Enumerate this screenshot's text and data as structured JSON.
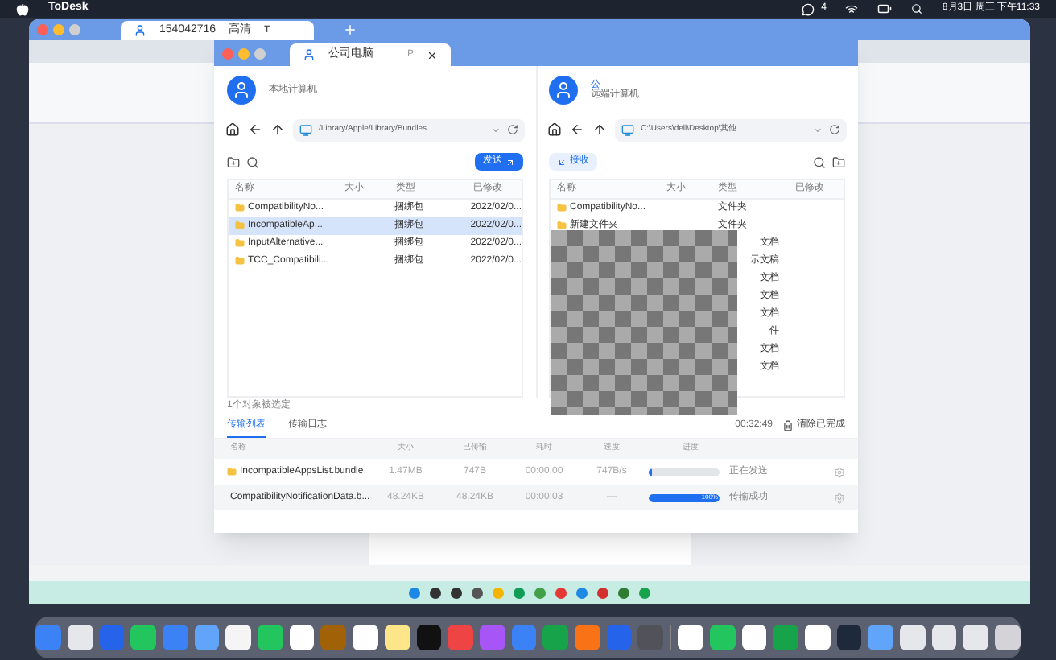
{
  "menu_bar": {
    "app": "ToDesk",
    "badge": "4",
    "clock": "8月3日 周三 下午11:33"
  },
  "todesk_tab": {
    "id": "154042716",
    "quality": "高清",
    "mode": "T"
  },
  "transfer_window": {
    "tab": "公司电脑",
    "tab_mark": "P",
    "local": {
      "name": "本地计算机",
      "path": "/Library/Apple/Library/Bundles",
      "action": "发送",
      "columns": [
        "名称",
        "大小",
        "类型",
        "已修改"
      ],
      "rows": [
        {
          "name": "CompatibilityNo...",
          "type": "捆绑包",
          "modified": "2022/02/0...",
          "selected": false
        },
        {
          "name": "IncompatibleAp...",
          "type": "捆绑包",
          "modified": "2022/02/0...",
          "selected": true
        },
        {
          "name": "InputAlternative...",
          "type": "捆绑包",
          "modified": "2022/02/0...",
          "selected": false
        },
        {
          "name": "TCC_Compatibili...",
          "type": "捆绑包",
          "modified": "2022/02/0...",
          "selected": false
        }
      ],
      "status": "1个对象被选定"
    },
    "remote": {
      "name": "公",
      "subtitle": "远端计算机",
      "path": "C:\\Users\\dell\\Desktop\\其他",
      "action": "接收",
      "columns": [
        "名称",
        "大小",
        "类型",
        "已修改"
      ],
      "rows": [
        {
          "name": "CompatibilityNo...",
          "type": "文件夹"
        },
        {
          "name": "新建文件夹",
          "type": "文件夹"
        },
        {
          "type": "文档"
        },
        {
          "type": "示文稿"
        },
        {
          "type": "文档"
        },
        {
          "type": "文档"
        },
        {
          "type": "文档"
        },
        {
          "type": "件"
        },
        {
          "type": "文档"
        },
        {
          "type": "文档"
        }
      ]
    },
    "transfer_tabs": [
      {
        "label": "传输列表",
        "selected": true
      },
      {
        "label": "传输日志",
        "selected": false
      }
    ],
    "time_left": "00:32:49",
    "clear_button": "清除已完成",
    "transfer_columns": [
      "名称",
      "大小",
      "已传输",
      "耗时",
      "速度",
      "进度"
    ],
    "transfers": [
      {
        "name": "IncompatibleAppsList.bundle",
        "size": "1.47MB",
        "sent": "747B",
        "time": "00:00:00",
        "speed": "747B/s",
        "level": 0.05,
        "status": "正在发送"
      },
      {
        "name": "CompatibilityNotificationData.b...",
        "size": "48.24KB",
        "sent": "48.24KB",
        "time": "00:00:03",
        "speed": "—",
        "level": 1,
        "percent": "100%",
        "status": "传输成功"
      }
    ]
  }
}
